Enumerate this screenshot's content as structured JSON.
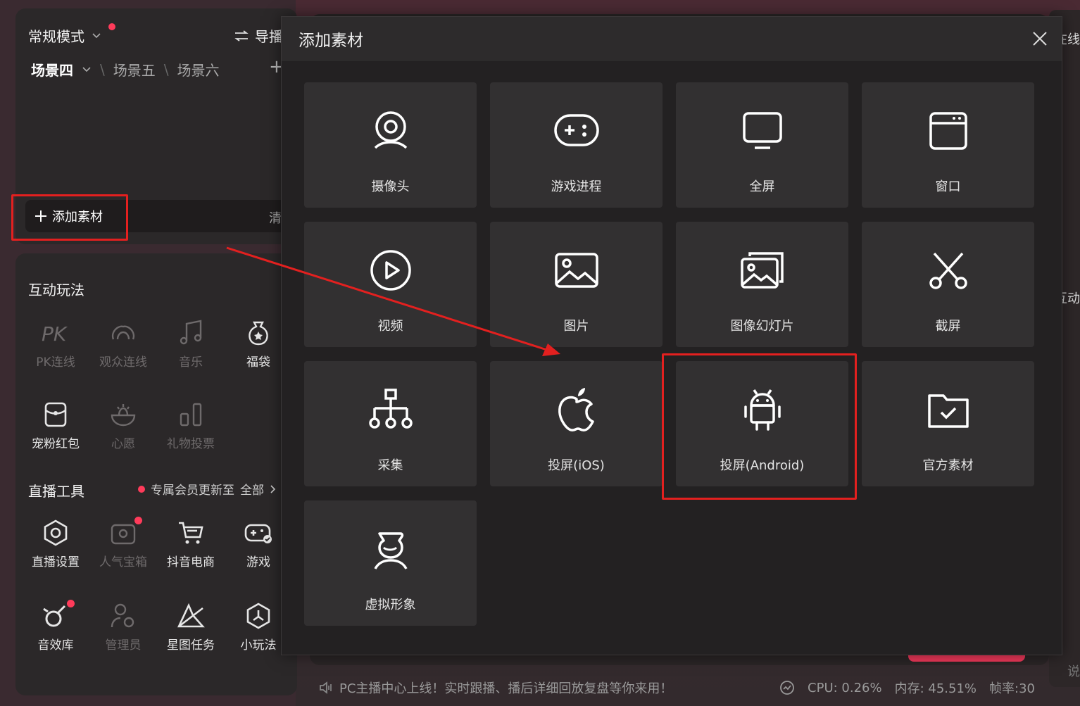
{
  "left": {
    "mode_label": "常规模式",
    "guide_label": "导播",
    "scenes": [
      "场景四",
      "场景五",
      "场景六"
    ],
    "add_material": "添加素材",
    "clear": "清空",
    "interactive_title": "互动玩法",
    "interactive_items": [
      {
        "label": "PK连线",
        "icon": "pk-icon",
        "enabled": false
      },
      {
        "label": "观众连线",
        "icon": "audience-link-icon",
        "enabled": false
      },
      {
        "label": "音乐",
        "icon": "music-icon",
        "enabled": false
      },
      {
        "label": "福袋",
        "icon": "lucky-bag-icon",
        "enabled": true
      },
      {
        "label": "宠粉红包",
        "icon": "red-packet-icon",
        "enabled": true
      },
      {
        "label": "心愿",
        "icon": "wish-icon",
        "enabled": false
      },
      {
        "label": "礼物投票",
        "icon": "gift-vote-icon",
        "enabled": false
      }
    ],
    "tools_title": "直播工具",
    "vip_note": "专属会员更新至",
    "all_label": "全部",
    "tools": [
      {
        "label": "直播设置",
        "icon": "settings-icon",
        "enabled": true
      },
      {
        "label": "人气宝箱",
        "icon": "treasure-box-icon",
        "enabled": false
      },
      {
        "label": "抖音电商",
        "icon": "cart-icon",
        "enabled": true
      },
      {
        "label": "游戏",
        "icon": "gamepad-icon",
        "enabled": true
      },
      {
        "label": "音效库",
        "icon": "sound-effect-icon",
        "enabled": true
      },
      {
        "label": "管理员",
        "icon": "admin-icon",
        "enabled": false
      },
      {
        "label": "星图任务",
        "icon": "star-map-icon",
        "enabled": true
      },
      {
        "label": "小玩法",
        "icon": "mini-game-icon",
        "enabled": true
      }
    ]
  },
  "modal": {
    "title": "添加素材",
    "tiles": [
      {
        "label": "摄像头",
        "icon": "camera-icon"
      },
      {
        "label": "游戏进程",
        "icon": "game-process-icon"
      },
      {
        "label": "全屏",
        "icon": "monitor-icon"
      },
      {
        "label": "窗口",
        "icon": "window-icon"
      },
      {
        "label": "视频",
        "icon": "play-icon"
      },
      {
        "label": "图片",
        "icon": "image-icon"
      },
      {
        "label": "图像幻灯片",
        "icon": "slideshow-icon"
      },
      {
        "label": "截屏",
        "icon": "scissors-icon"
      },
      {
        "label": "采集",
        "icon": "capture-icon"
      },
      {
        "label": "投屏(iOS)",
        "icon": "apple-icon"
      },
      {
        "label": "投屏(Android)",
        "icon": "android-icon"
      },
      {
        "label": "官方素材",
        "icon": "folder-check-icon"
      },
      {
        "label": "虚拟形象",
        "icon": "avatar-icon"
      }
    ]
  },
  "right": {
    "side_top": "在线",
    "side_mid": "互动",
    "side_bottom": "说"
  },
  "status": {
    "notice": "PC主播中心上线！实时跟播、播后详细回放复盘等你来用！",
    "cpu": "CPU: 0.26%",
    "memory": "内存: 45.51%",
    "fps": "帧率:30"
  },
  "colors": {
    "accent": "#ff3b5a",
    "highlight": "#e3201f"
  }
}
